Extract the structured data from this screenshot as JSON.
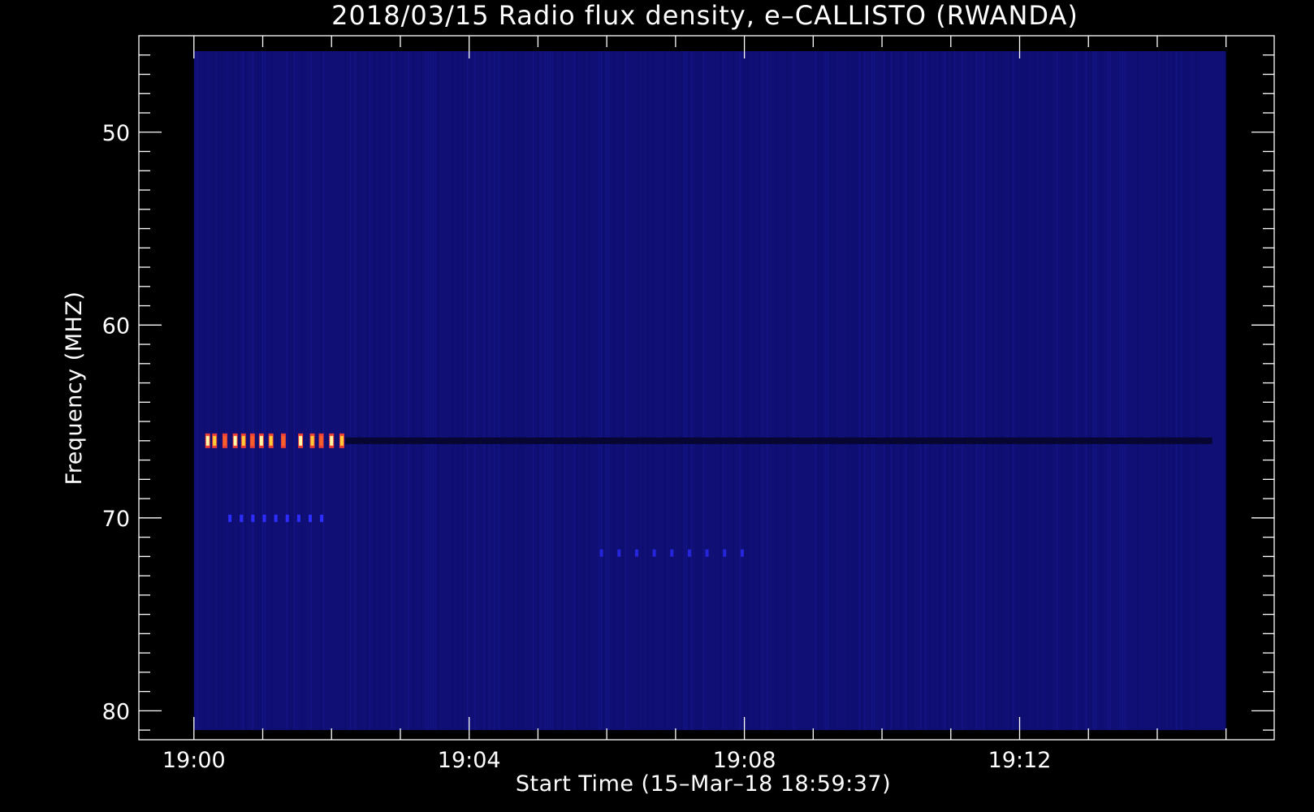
{
  "chart_data": {
    "type": "heatmap",
    "title": "2018/03/15  Radio flux density, e–CALLISTO (RWANDA)",
    "xlabel": "Start Time (15–Mar–18 18:59:37)",
    "ylabel": "Frequency (MHZ)",
    "x_ticks": [
      "19:00",
      "19:04",
      "19:08",
      "19:12"
    ],
    "x_tick_values_min": [
      0,
      4,
      8,
      12
    ],
    "y_ticks": [
      "50",
      "60",
      "70",
      "80"
    ],
    "y_tick_values": [
      50,
      60,
      70,
      80
    ],
    "x_range_min": [
      -0.8,
      15.7
    ],
    "y_range_mhz": [
      45,
      81.5
    ],
    "data_x_range_min": [
      0,
      15
    ],
    "data_y_range_mhz": [
      45.8,
      81
    ],
    "y_axis_inverted": true,
    "colormap": "blue-red-yellow-white",
    "background_level": 0.22,
    "features": [
      {
        "name": "bright burst train",
        "freq_mhz": 66,
        "t_start_min": 0.15,
        "t_end_min": 2.2,
        "level": 1.0
      },
      {
        "name": "weak band at 66 MHz",
        "freq_mhz": 66,
        "t_start_min": 2.2,
        "t_end_min": 14.8,
        "level": 0.05
      },
      {
        "name": "harmonic band",
        "freq_mhz": 70,
        "t_start_min": 0.5,
        "t_end_min": 2.0,
        "level": 0.45
      },
      {
        "name": "weak band at 72 MHz",
        "freq_mhz": 71.8,
        "t_start_min": 5.9,
        "t_end_min": 8.2,
        "level": 0.4
      }
    ]
  }
}
